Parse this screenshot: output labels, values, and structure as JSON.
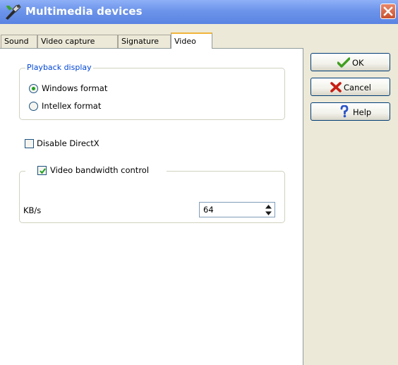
{
  "window": {
    "title": "Multimedia devices",
    "title_icon": "wrench-icon",
    "close_icon": "close-icon"
  },
  "tabs": [
    {
      "label": "Sound",
      "active": false
    },
    {
      "label": "Video capture",
      "active": false
    },
    {
      "label": "Signature",
      "active": false
    },
    {
      "label": "Video",
      "active": true
    }
  ],
  "playback_group": {
    "legend": "Playback display",
    "options": [
      {
        "label": "Windows format",
        "selected": true
      },
      {
        "label": "Intellex format",
        "selected": false
      }
    ]
  },
  "disable_directx": {
    "label": "Disable DirectX",
    "checked": false
  },
  "bandwidth_group": {
    "label": "Video bandwidth control",
    "checked": true,
    "kbs_label": "KB/s",
    "kbs_value": "64"
  },
  "buttons": {
    "ok": {
      "label": "OK",
      "icon": "checkmark-icon"
    },
    "cancel": {
      "label": "Cancel",
      "icon": "x-icon"
    },
    "help": {
      "label": "Help",
      "icon": "question-icon"
    }
  },
  "colors": {
    "titlebar": "#6c94ea",
    "tab_active_accent": "#f1b53b",
    "legend_text": "#0046d5",
    "radio_dot": "#21a121",
    "ok_icon": "#3f9f1f",
    "cancel_icon": "#c81e14",
    "help_icon": "#2c54c8"
  }
}
